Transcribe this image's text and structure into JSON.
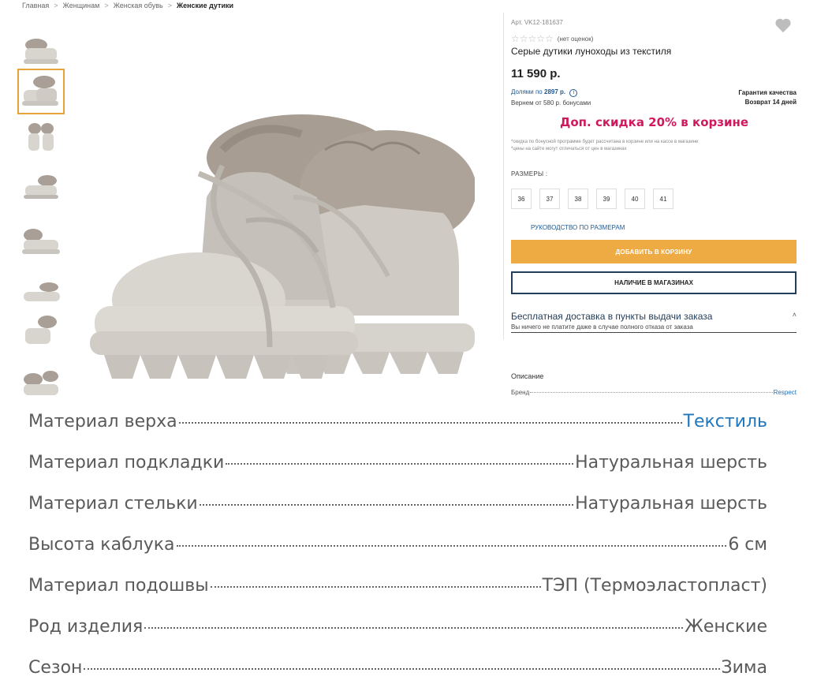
{
  "breadcrumb": {
    "items": [
      "Главная",
      "Женщинам",
      "Женская обувь"
    ],
    "current": "Женские дутики",
    "separator": ">"
  },
  "product": {
    "article": "Арт. VK12-181637",
    "rating_text": "(нет оценок)",
    "stars": "☆☆☆☆☆",
    "title": "Серые дутики луноходы из текстиля",
    "price": "11 590 р."
  },
  "payment": {
    "dolyami_prefix": "Долями по",
    "dolyami_amount": "2897 р.",
    "info_icon": "i",
    "bonus_text": "Вернем от 580 р. бонусами",
    "guarantee": "Гарантия качества",
    "return": "Возврат 14 дней"
  },
  "promo": "Доп. скидка 20% в корзине",
  "notes": [
    "*скидка по бонусной программе будет рассчитана в корзине или на кассе в магазине",
    "*цены на сайте могут отличаться от цен в магазинах"
  ],
  "sizes": {
    "label": "РАЗМЕРЫ :",
    "values": [
      "36",
      "37",
      "38",
      "39",
      "40",
      "41"
    ],
    "guide": "РУКОВОДСТВО ПО РАЗМЕРАМ"
  },
  "buttons": {
    "add_to_cart": "ДОБАВИТЬ В КОРЗИНУ",
    "stores": "НАЛИЧИЕ В МАГАЗИНАХ"
  },
  "delivery": {
    "title": "Бесплатная доставка в пункты выдачи заказа",
    "chevron": "˄",
    "subtitle": "Вы ничего не платите даже в случае полного отказа от заказа"
  },
  "description": {
    "heading": "Описание",
    "brand_label": "Бренд",
    "brand_value": "Respect"
  },
  "specs": [
    {
      "label": "Материал верха",
      "value": "Текстиль"
    },
    {
      "label": "Материал подкладки",
      "value": "Натуральная шерсть"
    },
    {
      "label": "Материал стельки",
      "value": "Натуральная шерсть"
    },
    {
      "label": "Высота каблука",
      "value": "6 см"
    },
    {
      "label": "Материал подошвы",
      "value": "ТЭП (Термоэластопласт)"
    },
    {
      "label": "Род изделия",
      "value": "Женские"
    },
    {
      "label": "Сезон",
      "value": "Зима"
    }
  ],
  "colors": {
    "accent": "#eeaa43",
    "promo": "#d0185c",
    "link": "#1f5a96",
    "navy": "#233e5c"
  }
}
